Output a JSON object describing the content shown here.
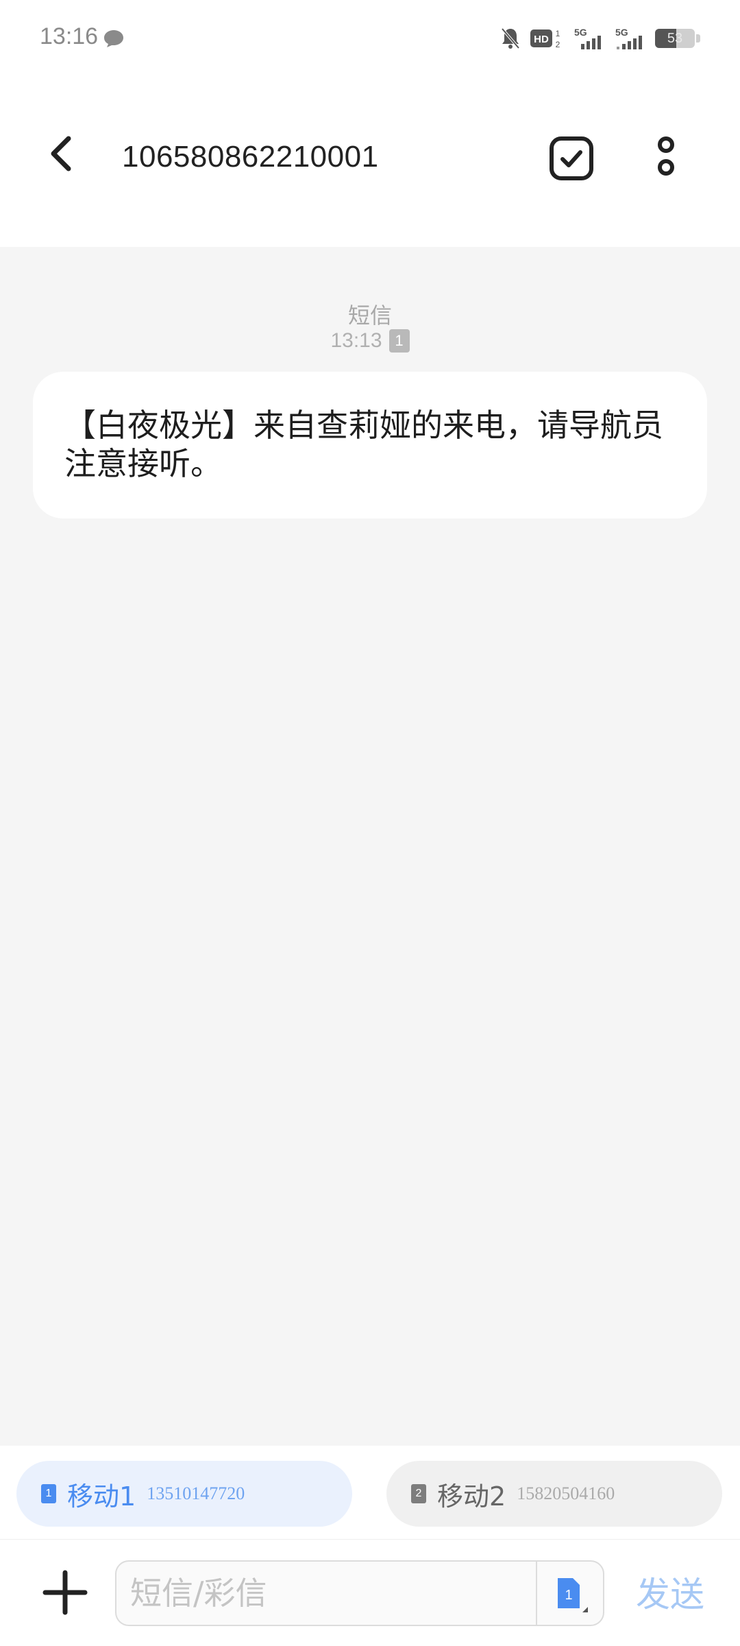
{
  "status_bar": {
    "time": "13:16",
    "battery": 53,
    "icons": [
      "message-icon",
      "bell-muted-icon",
      "hd-icon",
      "signal-5g-1-icon",
      "signal-5g-2-icon",
      "battery-icon"
    ],
    "hd_label": "HD",
    "net1": "5G",
    "net2": "5G"
  },
  "header": {
    "title": "106580862210001",
    "icons": [
      "back-icon",
      "select-check-icon",
      "more-icon"
    ]
  },
  "conversation": {
    "messages": [
      {
        "type_label": "短信",
        "time": "13:13",
        "sim": "1",
        "text": "【白夜极光】来自查莉娅的来电，请导航员注意接听。"
      }
    ]
  },
  "sim_selector": {
    "options": [
      {
        "sim_badge": "1",
        "name": "移动1",
        "number": "13510147720",
        "selected": true
      },
      {
        "sim_badge": "2",
        "name": "移动2",
        "number": "15820504160",
        "selected": false
      }
    ],
    "accent_color": "#4a8cf0"
  },
  "composer": {
    "placeholder": "短信/彩信",
    "value": "",
    "sim_badge": "1",
    "send_label": "发送"
  }
}
